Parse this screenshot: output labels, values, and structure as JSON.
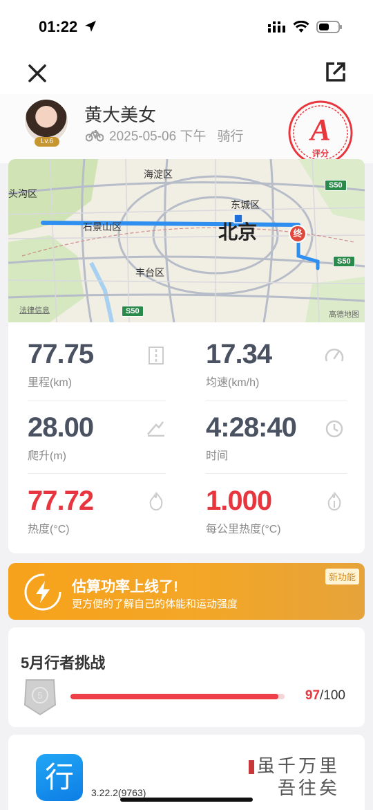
{
  "status_bar": {
    "time": "01:22"
  },
  "header": {
    "user_name": "黄大美女",
    "level": "Lv.6",
    "date": "2025-05-06 下午",
    "activity": "骑行",
    "grade_letter": "A",
    "grade_label": "评分"
  },
  "map": {
    "labels": {
      "haidian": "海淀区",
      "mentougou": "头沟区",
      "dongcheng": "东城区",
      "shijingshan": "石景山区",
      "city": "北京",
      "fengtai": "丰台区",
      "legal": "法律信息",
      "provider": "高德地图",
      "end_marker": "终"
    },
    "highway": "S50"
  },
  "stats": [
    {
      "value": "77.75",
      "label": "里程(km)",
      "icon": "road-icon",
      "red": false
    },
    {
      "value": "17.34",
      "label": "均速(km/h)",
      "icon": "speedometer-icon",
      "red": false
    },
    {
      "value": "28.00",
      "label": "爬升(m)",
      "icon": "climb-icon",
      "red": false
    },
    {
      "value": "4:28:40",
      "label": "时间",
      "icon": "clock-icon",
      "red": false
    },
    {
      "value": "77.72",
      "label": "热度(°C)",
      "icon": "flame-icon",
      "red": true
    },
    {
      "value": "1.000",
      "label": "每公里热度(°C)",
      "icon": "flame-outline-icon",
      "red": true
    }
  ],
  "banner": {
    "title": "估算功率上线了!",
    "subtitle": "更方便的了解自己的体能和运动强度",
    "badge": "新功能"
  },
  "challenge": {
    "title": "5月行者挑战",
    "current": "97",
    "total": "/100",
    "progress": 0.97
  },
  "footer": {
    "app_logo_text": "行",
    "version": "3.22.2(9763)",
    "slogan_line1": "虽千万里",
    "slogan_line2": "吾往矣"
  },
  "colors": {
    "accent_red": "#e8363e",
    "route_blue": "#2f8ff0",
    "banner_orange": "#f7a21b"
  }
}
